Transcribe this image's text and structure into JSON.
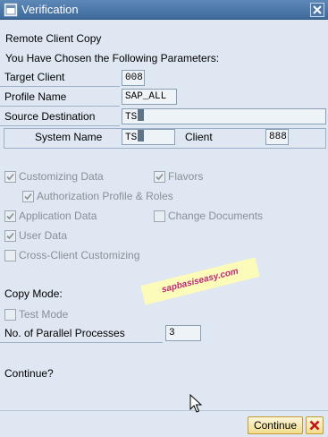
{
  "window": {
    "title": "Verification"
  },
  "header": {
    "line1": "Remote Client Copy",
    "line2": "You Have Chosen the Following Parameters:"
  },
  "fields": {
    "target_client": {
      "label": "Target Client",
      "value": "008"
    },
    "profile_name": {
      "label": "Profile Name",
      "value": "SAP_ALL"
    },
    "source_destination": {
      "label": "Source Destination",
      "value": "TS"
    },
    "system_name": {
      "label": "System Name",
      "value": "TS"
    },
    "client": {
      "label": "Client",
      "value": "888"
    }
  },
  "options": {
    "customizing_data": {
      "label": "Customizing Data",
      "checked": true
    },
    "flavors": {
      "label": "Flavors",
      "checked": true
    },
    "authorization_profile": {
      "label": "Authorization Profile & Roles",
      "checked": true
    },
    "application_data": {
      "label": "Application Data",
      "checked": true
    },
    "change_documents": {
      "label": "Change Documents",
      "checked": false
    },
    "user_data": {
      "label": "User Data",
      "checked": true
    },
    "cross_client": {
      "label": "Cross-Client Customizing",
      "checked": false
    }
  },
  "copy_mode": {
    "label": "Copy Mode:",
    "test_mode": {
      "label": "Test Mode",
      "checked": false
    },
    "parallel_label": "No. of Parallel Processes",
    "parallel_value": "3"
  },
  "watermark": "sapbasiseasy.com",
  "prompt": "Continue?",
  "buttons": {
    "continue": "Continue"
  },
  "colors": {
    "titlebar": "#4a76a8",
    "background": "#dfe8f2",
    "button": "#f2dc8e"
  }
}
